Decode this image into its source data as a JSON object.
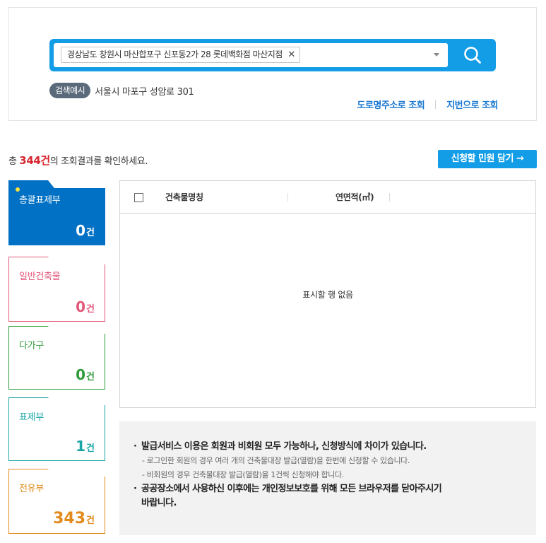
{
  "search": {
    "selected_address": "경상남도 창원시 마산합포구 신포동2가 28 롯데백화점 마산지점",
    "remove_glyph": "✕",
    "example_badge": "검색예시",
    "example_text": "서울시 마포구 성암로 301",
    "link_road": "도로명주소로 조회",
    "link_lot": "지번으로 조회",
    "accent_color": "#139de6"
  },
  "results": {
    "prefix": "총 ",
    "count": "344건",
    "suffix": "의 조회결과를 확인하세요.",
    "cart_button": "신청할 민원 담기 →"
  },
  "categories": [
    {
      "label": "총괄표제부",
      "count": "0",
      "unit": "건",
      "color": "#0071c5",
      "active": true
    },
    {
      "label": "일반건축물",
      "count": "0",
      "unit": "건",
      "color": "#e2577a",
      "active": false
    },
    {
      "label": "다가구",
      "count": "0",
      "unit": "건",
      "color": "#2e9b3a",
      "active": false
    },
    {
      "label": "표제부",
      "count": "1",
      "unit": "건",
      "color": "#1aa5a5",
      "active": false
    },
    {
      "label": "전유부",
      "count": "343",
      "unit": "건",
      "color": "#e28a1c",
      "active": false
    }
  ],
  "table": {
    "col_name": "건축물명칭",
    "col_area": "연면적(㎡)",
    "empty": "표시할 행 없음"
  },
  "notice": {
    "line1": "발급서비스 이용은 회원과 비회원 모두 가능하나, 신청방식에 차이가 있습니다.",
    "line2": "- 로그인한 회원의 경우 여러 개의 건축물대장 발급(열람)을 한번에 신청할 수 있습니다.",
    "line3": "- 비회원의 경우 건축물대장 발급(열람)을 1건씩 신청해야 합니다.",
    "line4a": "공공장소에서 사용하신 이후에는 개인정보보호를 위해 모든 브라우저를 닫아주시기",
    "line4b": "바랍니다.",
    "bullet": "·"
  }
}
